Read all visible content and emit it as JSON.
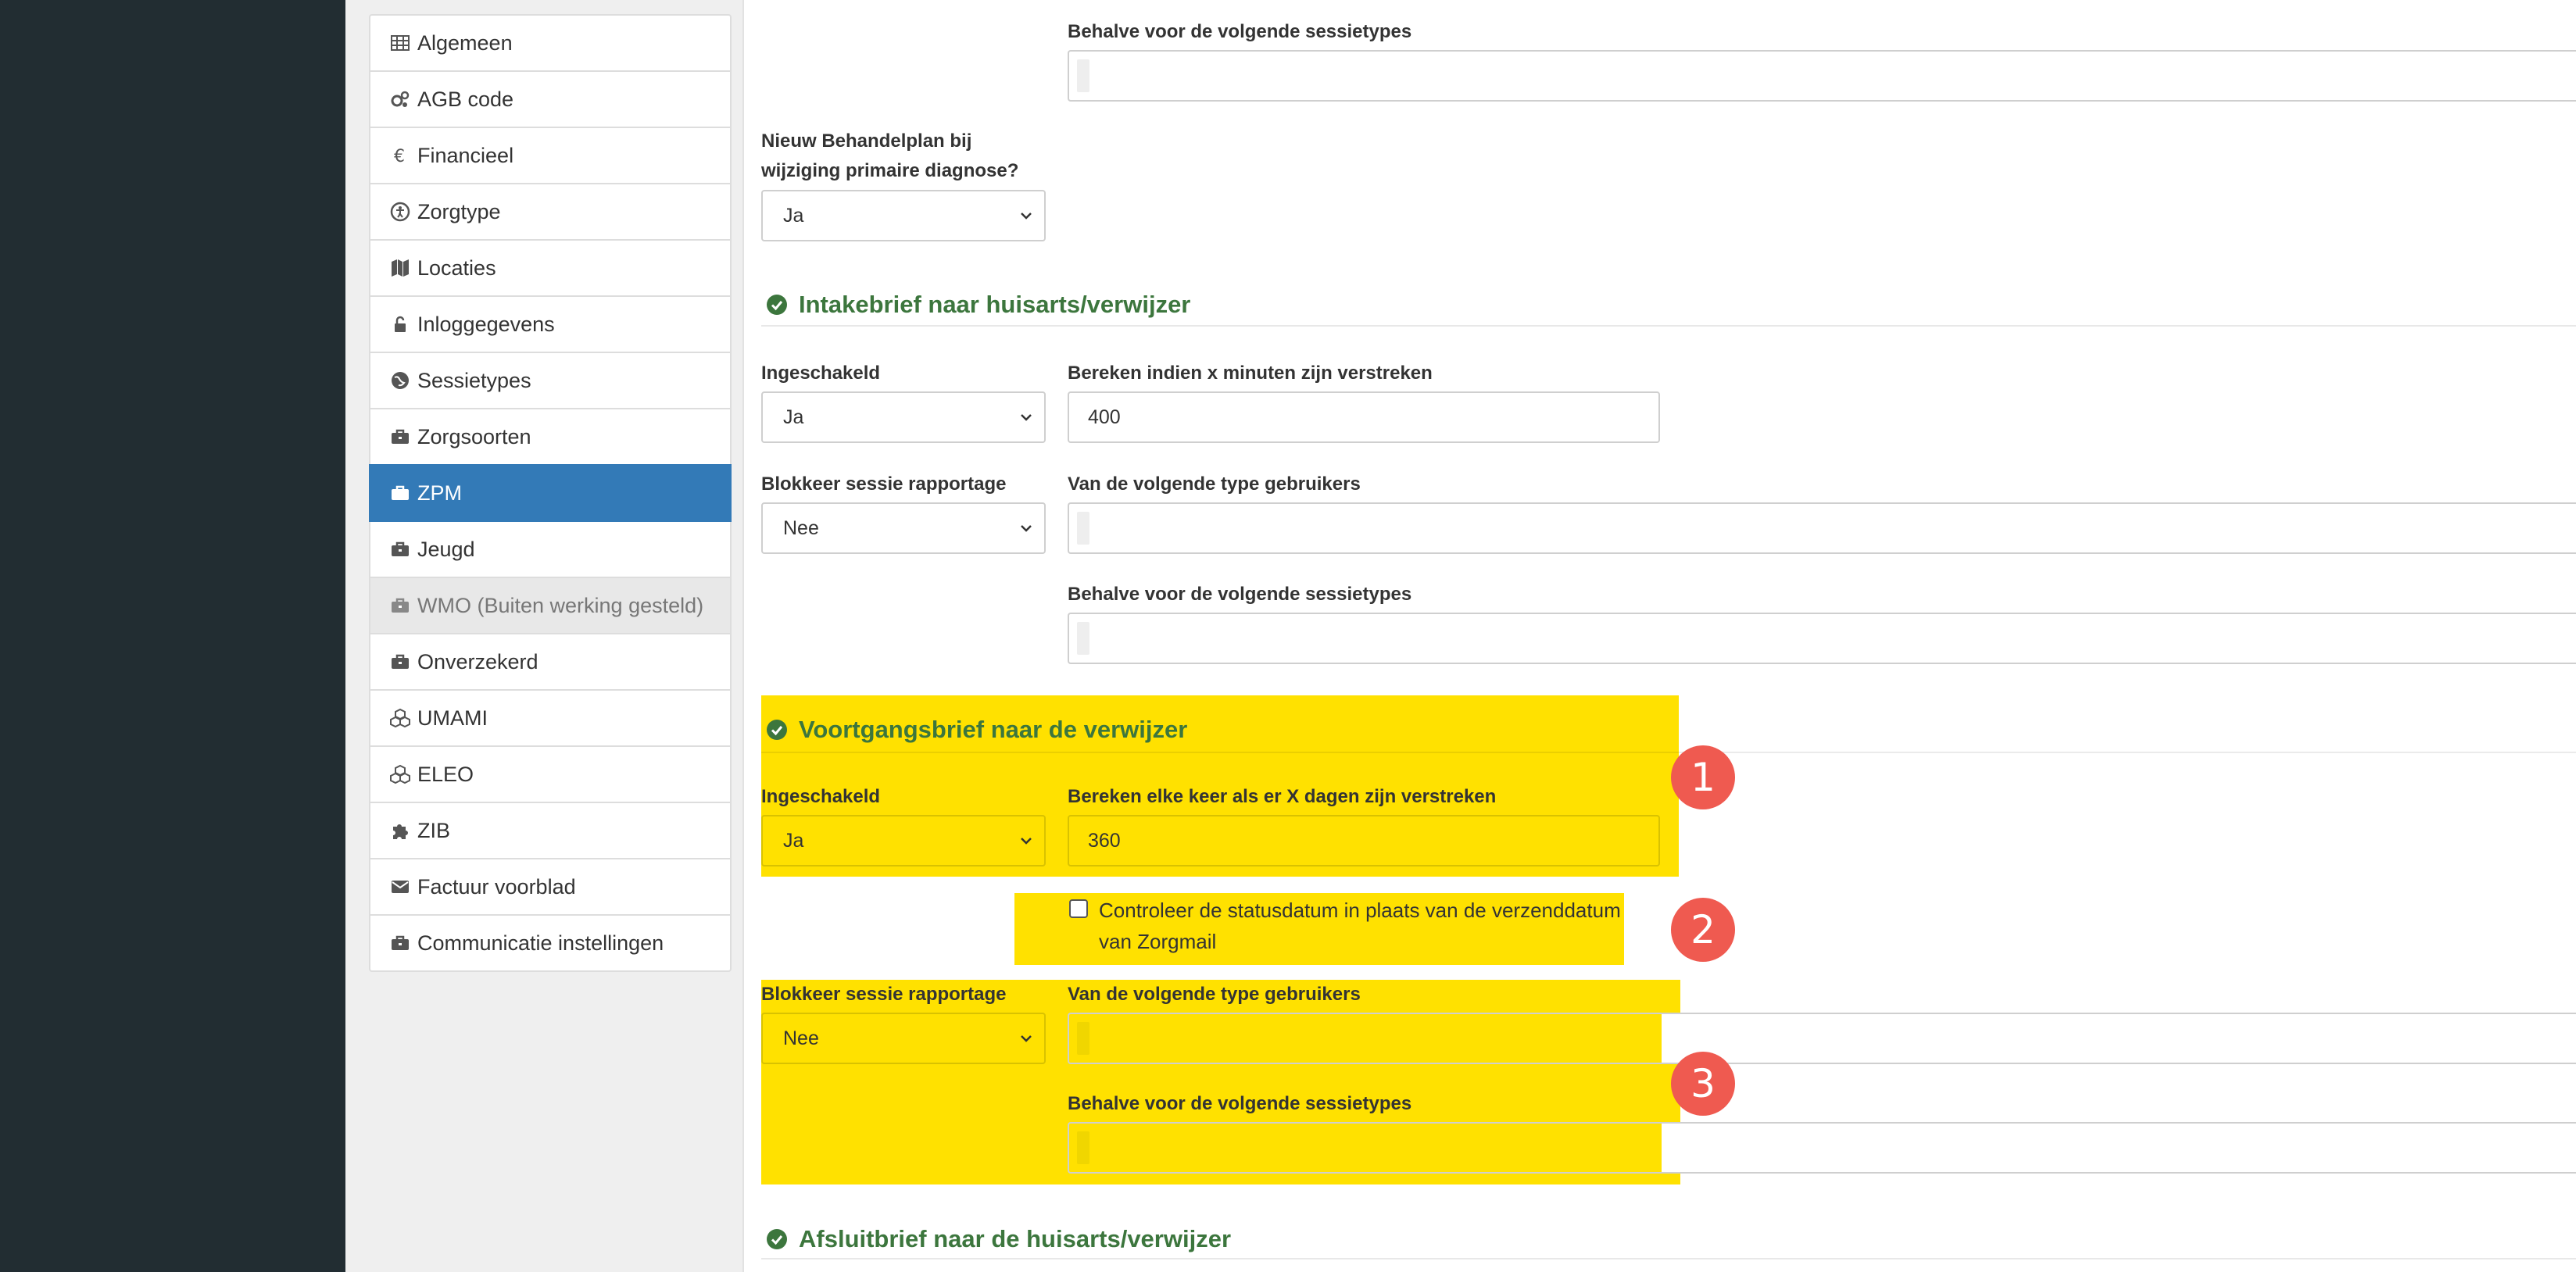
{
  "nav": {
    "items": [
      {
        "label": "Algemeen",
        "icon": "table-icon"
      },
      {
        "label": "AGB code",
        "icon": "gears-icon"
      },
      {
        "label": "Financieel",
        "icon": "euro-icon"
      },
      {
        "label": "Zorgtype",
        "icon": "accessibility-icon"
      },
      {
        "label": "Locaties",
        "icon": "map-icon"
      },
      {
        "label": "Inloggegevens",
        "icon": "unlock-icon"
      },
      {
        "label": "Sessietypes",
        "icon": "globe-icon"
      },
      {
        "label": "Zorgsoorten",
        "icon": "briefcase-icon"
      },
      {
        "label": "ZPM",
        "icon": "briefcase-icon",
        "active": true
      },
      {
        "label": "Jeugd",
        "icon": "briefcase-icon"
      },
      {
        "label": "WMO (Buiten werking gesteld)",
        "icon": "briefcase-icon",
        "disabled": true
      },
      {
        "label": "Onverzekerd",
        "icon": "briefcase-icon"
      },
      {
        "label": "UMAMI",
        "icon": "cubes-icon"
      },
      {
        "label": "ELEO",
        "icon": "cubes-icon"
      },
      {
        "label": "ZIB",
        "icon": "puzzle-icon"
      },
      {
        "label": "Factuur voorblad",
        "icon": "envelope-icon"
      },
      {
        "label": "Communicatie instellingen",
        "icon": "briefcase-icon"
      }
    ]
  },
  "top": {
    "except_session_types_label": "Behalve voor de volgende sessietypes",
    "new_plan_label_line1": "Nieuw Behandelplan bij",
    "new_plan_label_line2": "wijziging primaire diagnose?",
    "new_plan_value": "Ja"
  },
  "intake": {
    "title": "Intakebrief naar huisarts/verwijzer",
    "enabled_label": "Ingeschakeld",
    "enabled_value": "Ja",
    "minutes_label": "Bereken indien x minuten zijn verstreken",
    "minutes_value": "400",
    "block_label": "Blokkeer sessie rapportage",
    "block_value": "Nee",
    "user_types_label": "Van de volgende type gebruikers",
    "except_label": "Behalve voor de volgende sessietypes"
  },
  "progress": {
    "title": "Voortgangsbrief naar de verwijzer",
    "enabled_label": "Ingeschakeld",
    "enabled_value": "Ja",
    "days_label": "Bereken elke keer als er X dagen zijn verstreken",
    "days_value": "360",
    "checkbox_label_line1": "Controleer de statusdatum in plaats van de verzenddatum",
    "checkbox_label_line2": "van Zorgmail",
    "block_label": "Blokkeer sessie rapportage",
    "block_value": "Nee",
    "user_types_label": "Van de volgende type gebruikers",
    "except_label": "Behalve voor de volgende sessietypes"
  },
  "closing": {
    "title": "Afsluitbrief naar de huisarts/verwijzer"
  },
  "badges": [
    "1",
    "2",
    "3"
  ],
  "colors": {
    "highlight": "#ffe100",
    "badge": "#ef5a50",
    "active_nav": "#337ab7",
    "section_title": "#3c763d"
  }
}
